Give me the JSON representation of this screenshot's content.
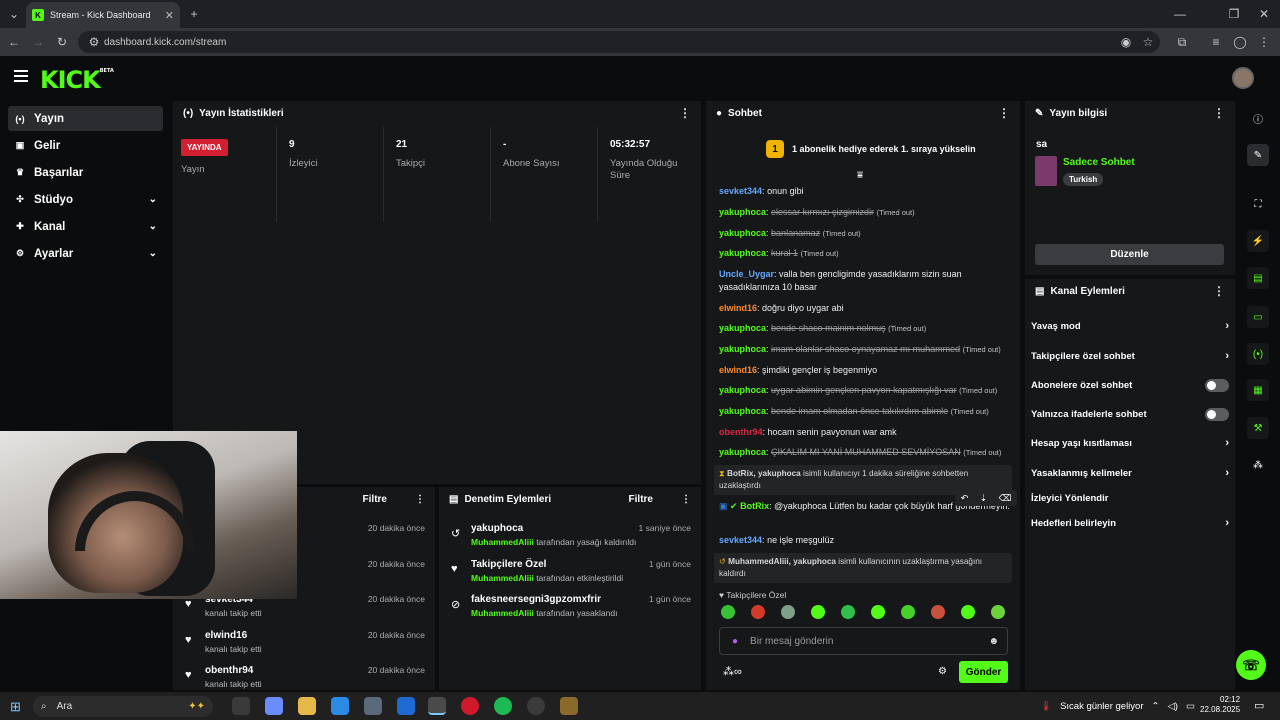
{
  "browser": {
    "tab_title": "Stream - Kick Dashboard",
    "url": "dashboard.kick.com/stream"
  },
  "app": {
    "logo": "KICK",
    "logo_badge": "BETA"
  },
  "sidebar": {
    "items": [
      {
        "label": "Yayın",
        "icon": "broadcast-icon",
        "active": true
      },
      {
        "label": "Gelir",
        "icon": "revenue-icon"
      },
      {
        "label": "Başarılar",
        "icon": "trophy-icon"
      },
      {
        "label": "Stüdyo",
        "icon": "studio-icon",
        "expandable": true
      },
      {
        "label": "Kanal",
        "icon": "channel-icon",
        "expandable": true
      },
      {
        "label": "Ayarlar",
        "icon": "settings-icon",
        "expandable": true
      }
    ]
  },
  "stats": {
    "title": "Yayın İstatistikleri",
    "live_badge": "YAYINDA",
    "cells": [
      {
        "value": "YAYINDA",
        "label": "Yayın"
      },
      {
        "value": "9",
        "label": "İzleyici"
      },
      {
        "value": "21",
        "label": "Takipçi"
      },
      {
        "value": "-",
        "label": "Abone Sayısı"
      },
      {
        "value": "05:32:57",
        "label": "Yayında Olduğu Süre"
      }
    ]
  },
  "activity": {
    "filter": "Filtre",
    "rows": [
      {
        "name": "",
        "sub": "",
        "time": "20 dakika önce"
      },
      {
        "name": "",
        "sub": "",
        "time": "20 dakika önce"
      },
      {
        "name": "sevket344",
        "sub": "kanalı takip etti",
        "time": "20 dakika önce"
      },
      {
        "name": "elwind16",
        "sub": "kanalı takip etti",
        "time": "20 dakika önce"
      },
      {
        "name": "obenthr94",
        "sub": "kanalı takip etti",
        "time": "20 dakika önce"
      }
    ]
  },
  "moderation": {
    "title": "Denetim Eylemleri",
    "filter": "Filtre",
    "rows": [
      {
        "name": "yakuphoca",
        "actor": "MuhammedAliii",
        "action": "tarafından yasağı kaldırıldı",
        "time": "1 saniye önce"
      },
      {
        "name": "Takipçilere Özel",
        "actor": "MuhammedAliii",
        "action": "tarafından etkinleştirildi",
        "time": "1 gün önce"
      },
      {
        "name": "fakesneersegni3gpzomxfrir",
        "actor": "MuhammedAliii",
        "action": "tarafından yasaklandı",
        "time": "1 gün önce"
      }
    ]
  },
  "chat": {
    "title": "Sohbet",
    "pinned": "1 abonelik hediye ederek 1. sıraya yükselin",
    "pinned_badge": "1",
    "messages": [
      {
        "user": "sevket344",
        "color": "#64a9ff",
        "text": "onun gibi",
        "deleted": false
      },
      {
        "user": "yakuphoca",
        "color": "#53fc18",
        "text": "elessar kırmızı çizgimizdir",
        "deleted": true,
        "note": "(Timed out)"
      },
      {
        "user": "yakuphoca",
        "color": "#53fc18",
        "text": "banlanamaz",
        "deleted": true,
        "note": "(Timed out)"
      },
      {
        "user": "yakuphoca",
        "color": "#53fc18",
        "text": "kural 1",
        "deleted": true,
        "note": "(Timed out)"
      },
      {
        "user": "Uncle_Uygar",
        "color": "#64a9ff",
        "text": "valla ben gencligimde yasadıklarım sizin suan yasadıklarınıza 10 basar",
        "deleted": false
      },
      {
        "user": "elwind16",
        "color": "#ff8a2b",
        "text": "doğru diyo uygar abi",
        "deleted": false
      },
      {
        "user": "yakuphoca",
        "color": "#53fc18",
        "text": "bende shaco mainim nolmuş",
        "deleted": true,
        "note": "(Timed out)"
      },
      {
        "user": "yakuphoca",
        "color": "#53fc18",
        "text": "imam olanlar shaco oynayamaz mı muhammed",
        "deleted": true,
        "note": "(Timed out)"
      },
      {
        "user": "elwind16",
        "color": "#ff8a2b",
        "text": "şimdiki gençler iş begenmiyo",
        "deleted": false
      },
      {
        "user": "yakuphoca",
        "color": "#53fc18",
        "text": "uygar abimin gençken pavyon kapatmışlığı var",
        "deleted": true,
        "note": "(Timed out)"
      },
      {
        "user": "yakuphoca",
        "color": "#53fc18",
        "text": "bende imam olmadan önce takılırdım abimle",
        "deleted": true,
        "note": "(Timed out)"
      },
      {
        "user": "obenthr94",
        "color": "#e0283e",
        "text": "hocam senin pavyonun war amk",
        "deleted": false
      },
      {
        "user": "yakuphoca",
        "color": "#53fc18",
        "text": "ÇIKALIM MI YANİ MUHAMMED SEVMİYOSAN",
        "deleted": true,
        "note": "(Timed out)"
      }
    ],
    "sys1": {
      "bold": "BotRix, yakuphoca",
      "text": "isimli kullanıcıyı 1 dakika süreliğine sohbetten uzaklaştırdı"
    },
    "bot_msg": {
      "user": "BotRix",
      "text": "@yakuphoca Lütfen bu kadar çok büyük harf göndermeyin."
    },
    "last_msg": {
      "user": "sevket344",
      "text": "ne işle meşgulüz"
    },
    "sys2": {
      "bold": "MuhammedAliii, yakuphoca",
      "text": "isimli kullanıcının uzaklaştırma yasağını kaldırdı"
    },
    "followers_only": "Takipçilere Özel",
    "input_placeholder": "Bir mesaj gönderin",
    "send": "Gönder"
  },
  "info": {
    "title": "Yayın bilgisi",
    "stream_title": "sa",
    "category": "Sadece Sohbet",
    "tag": "Turkish",
    "edit": "Düzenle"
  },
  "channel_actions": {
    "title": "Kanal Eylemleri",
    "items": [
      {
        "label": "Yavaş mod",
        "kind": "chevron"
      },
      {
        "label": "Takipçilere özel sohbet",
        "kind": "chevron"
      },
      {
        "label": "Abonelere özel sohbet",
        "kind": "toggle",
        "on": false
      },
      {
        "label": "Yalnızca ifadelerle sohbet",
        "kind": "toggle",
        "on": false
      },
      {
        "label": "Hesap yaşı kısıtlaması",
        "kind": "chevron"
      },
      {
        "label": "Yasaklanmış kelimeler",
        "kind": "chevron"
      },
      {
        "label": "İzleyici Yönlendir",
        "kind": "none"
      },
      {
        "label": "Hedefleri belirleyin",
        "kind": "chevron"
      }
    ]
  },
  "taskbar": {
    "search": "Ara",
    "weather": "Sıcak günler geliyor",
    "time": "02:12",
    "date": "22.08.2025"
  },
  "colors": {
    "accent": "#53fc18",
    "live": "#d21f31",
    "panel": "#151719",
    "bg": "#0b0c0d"
  }
}
